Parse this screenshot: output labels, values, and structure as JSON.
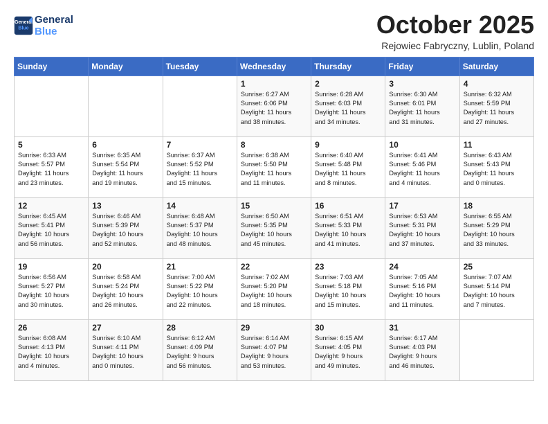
{
  "header": {
    "logo_line1": "General",
    "logo_line2": "Blue",
    "month_title": "October 2025",
    "location": "Rejowiec Fabryczny, Lublin, Poland"
  },
  "weekdays": [
    "Sunday",
    "Monday",
    "Tuesday",
    "Wednesday",
    "Thursday",
    "Friday",
    "Saturday"
  ],
  "weeks": [
    [
      {
        "day": "",
        "info": ""
      },
      {
        "day": "",
        "info": ""
      },
      {
        "day": "",
        "info": ""
      },
      {
        "day": "1",
        "info": "Sunrise: 6:27 AM\nSunset: 6:06 PM\nDaylight: 11 hours\nand 38 minutes."
      },
      {
        "day": "2",
        "info": "Sunrise: 6:28 AM\nSunset: 6:03 PM\nDaylight: 11 hours\nand 34 minutes."
      },
      {
        "day": "3",
        "info": "Sunrise: 6:30 AM\nSunset: 6:01 PM\nDaylight: 11 hours\nand 31 minutes."
      },
      {
        "day": "4",
        "info": "Sunrise: 6:32 AM\nSunset: 5:59 PM\nDaylight: 11 hours\nand 27 minutes."
      }
    ],
    [
      {
        "day": "5",
        "info": "Sunrise: 6:33 AM\nSunset: 5:57 PM\nDaylight: 11 hours\nand 23 minutes."
      },
      {
        "day": "6",
        "info": "Sunrise: 6:35 AM\nSunset: 5:54 PM\nDaylight: 11 hours\nand 19 minutes."
      },
      {
        "day": "7",
        "info": "Sunrise: 6:37 AM\nSunset: 5:52 PM\nDaylight: 11 hours\nand 15 minutes."
      },
      {
        "day": "8",
        "info": "Sunrise: 6:38 AM\nSunset: 5:50 PM\nDaylight: 11 hours\nand 11 minutes."
      },
      {
        "day": "9",
        "info": "Sunrise: 6:40 AM\nSunset: 5:48 PM\nDaylight: 11 hours\nand 8 minutes."
      },
      {
        "day": "10",
        "info": "Sunrise: 6:41 AM\nSunset: 5:46 PM\nDaylight: 11 hours\nand 4 minutes."
      },
      {
        "day": "11",
        "info": "Sunrise: 6:43 AM\nSunset: 5:43 PM\nDaylight: 11 hours\nand 0 minutes."
      }
    ],
    [
      {
        "day": "12",
        "info": "Sunrise: 6:45 AM\nSunset: 5:41 PM\nDaylight: 10 hours\nand 56 minutes."
      },
      {
        "day": "13",
        "info": "Sunrise: 6:46 AM\nSunset: 5:39 PM\nDaylight: 10 hours\nand 52 minutes."
      },
      {
        "day": "14",
        "info": "Sunrise: 6:48 AM\nSunset: 5:37 PM\nDaylight: 10 hours\nand 48 minutes."
      },
      {
        "day": "15",
        "info": "Sunrise: 6:50 AM\nSunset: 5:35 PM\nDaylight: 10 hours\nand 45 minutes."
      },
      {
        "day": "16",
        "info": "Sunrise: 6:51 AM\nSunset: 5:33 PM\nDaylight: 10 hours\nand 41 minutes."
      },
      {
        "day": "17",
        "info": "Sunrise: 6:53 AM\nSunset: 5:31 PM\nDaylight: 10 hours\nand 37 minutes."
      },
      {
        "day": "18",
        "info": "Sunrise: 6:55 AM\nSunset: 5:29 PM\nDaylight: 10 hours\nand 33 minutes."
      }
    ],
    [
      {
        "day": "19",
        "info": "Sunrise: 6:56 AM\nSunset: 5:27 PM\nDaylight: 10 hours\nand 30 minutes."
      },
      {
        "day": "20",
        "info": "Sunrise: 6:58 AM\nSunset: 5:24 PM\nDaylight: 10 hours\nand 26 minutes."
      },
      {
        "day": "21",
        "info": "Sunrise: 7:00 AM\nSunset: 5:22 PM\nDaylight: 10 hours\nand 22 minutes."
      },
      {
        "day": "22",
        "info": "Sunrise: 7:02 AM\nSunset: 5:20 PM\nDaylight: 10 hours\nand 18 minutes."
      },
      {
        "day": "23",
        "info": "Sunrise: 7:03 AM\nSunset: 5:18 PM\nDaylight: 10 hours\nand 15 minutes."
      },
      {
        "day": "24",
        "info": "Sunrise: 7:05 AM\nSunset: 5:16 PM\nDaylight: 10 hours\nand 11 minutes."
      },
      {
        "day": "25",
        "info": "Sunrise: 7:07 AM\nSunset: 5:14 PM\nDaylight: 10 hours\nand 7 minutes."
      }
    ],
    [
      {
        "day": "26",
        "info": "Sunrise: 6:08 AM\nSunset: 4:13 PM\nDaylight: 10 hours\nand 4 minutes."
      },
      {
        "day": "27",
        "info": "Sunrise: 6:10 AM\nSunset: 4:11 PM\nDaylight: 10 hours\nand 0 minutes."
      },
      {
        "day": "28",
        "info": "Sunrise: 6:12 AM\nSunset: 4:09 PM\nDaylight: 9 hours\nand 56 minutes."
      },
      {
        "day": "29",
        "info": "Sunrise: 6:14 AM\nSunset: 4:07 PM\nDaylight: 9 hours\nand 53 minutes."
      },
      {
        "day": "30",
        "info": "Sunrise: 6:15 AM\nSunset: 4:05 PM\nDaylight: 9 hours\nand 49 minutes."
      },
      {
        "day": "31",
        "info": "Sunrise: 6:17 AM\nSunset: 4:03 PM\nDaylight: 9 hours\nand 46 minutes."
      },
      {
        "day": "",
        "info": ""
      }
    ]
  ]
}
